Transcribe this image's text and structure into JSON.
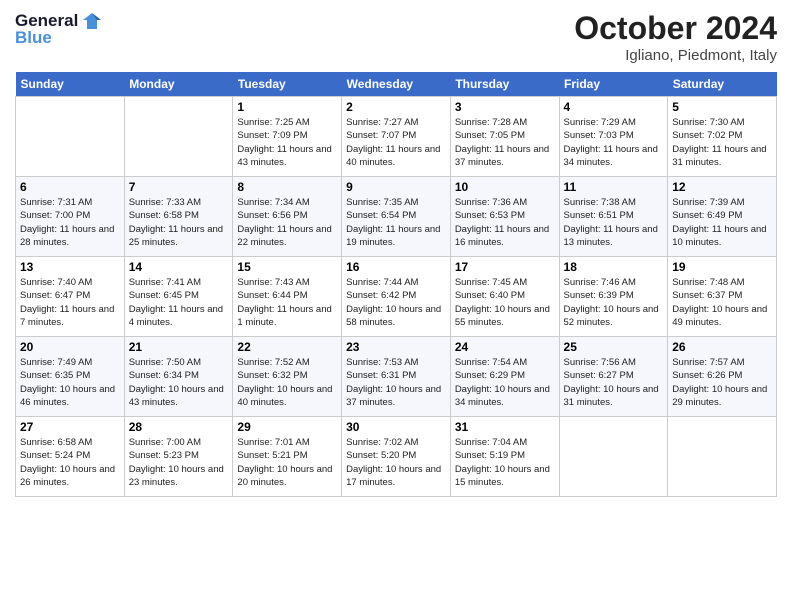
{
  "header": {
    "logo_general": "General",
    "logo_blue": "Blue",
    "month_title": "October 2024",
    "location": "Igliano, Piedmont, Italy"
  },
  "calendar": {
    "days_of_week": [
      "Sunday",
      "Monday",
      "Tuesday",
      "Wednesday",
      "Thursday",
      "Friday",
      "Saturday"
    ],
    "weeks": [
      [
        {
          "day": "",
          "sunrise": "",
          "sunset": "",
          "daylight": ""
        },
        {
          "day": "",
          "sunrise": "",
          "sunset": "",
          "daylight": ""
        },
        {
          "day": "1",
          "sunrise": "Sunrise: 7:25 AM",
          "sunset": "Sunset: 7:09 PM",
          "daylight": "Daylight: 11 hours and 43 minutes."
        },
        {
          "day": "2",
          "sunrise": "Sunrise: 7:27 AM",
          "sunset": "Sunset: 7:07 PM",
          "daylight": "Daylight: 11 hours and 40 minutes."
        },
        {
          "day": "3",
          "sunrise": "Sunrise: 7:28 AM",
          "sunset": "Sunset: 7:05 PM",
          "daylight": "Daylight: 11 hours and 37 minutes."
        },
        {
          "day": "4",
          "sunrise": "Sunrise: 7:29 AM",
          "sunset": "Sunset: 7:03 PM",
          "daylight": "Daylight: 11 hours and 34 minutes."
        },
        {
          "day": "5",
          "sunrise": "Sunrise: 7:30 AM",
          "sunset": "Sunset: 7:02 PM",
          "daylight": "Daylight: 11 hours and 31 minutes."
        }
      ],
      [
        {
          "day": "6",
          "sunrise": "Sunrise: 7:31 AM",
          "sunset": "Sunset: 7:00 PM",
          "daylight": "Daylight: 11 hours and 28 minutes."
        },
        {
          "day": "7",
          "sunrise": "Sunrise: 7:33 AM",
          "sunset": "Sunset: 6:58 PM",
          "daylight": "Daylight: 11 hours and 25 minutes."
        },
        {
          "day": "8",
          "sunrise": "Sunrise: 7:34 AM",
          "sunset": "Sunset: 6:56 PM",
          "daylight": "Daylight: 11 hours and 22 minutes."
        },
        {
          "day": "9",
          "sunrise": "Sunrise: 7:35 AM",
          "sunset": "Sunset: 6:54 PM",
          "daylight": "Daylight: 11 hours and 19 minutes."
        },
        {
          "day": "10",
          "sunrise": "Sunrise: 7:36 AM",
          "sunset": "Sunset: 6:53 PM",
          "daylight": "Daylight: 11 hours and 16 minutes."
        },
        {
          "day": "11",
          "sunrise": "Sunrise: 7:38 AM",
          "sunset": "Sunset: 6:51 PM",
          "daylight": "Daylight: 11 hours and 13 minutes."
        },
        {
          "day": "12",
          "sunrise": "Sunrise: 7:39 AM",
          "sunset": "Sunset: 6:49 PM",
          "daylight": "Daylight: 11 hours and 10 minutes."
        }
      ],
      [
        {
          "day": "13",
          "sunrise": "Sunrise: 7:40 AM",
          "sunset": "Sunset: 6:47 PM",
          "daylight": "Daylight: 11 hours and 7 minutes."
        },
        {
          "day": "14",
          "sunrise": "Sunrise: 7:41 AM",
          "sunset": "Sunset: 6:45 PM",
          "daylight": "Daylight: 11 hours and 4 minutes."
        },
        {
          "day": "15",
          "sunrise": "Sunrise: 7:43 AM",
          "sunset": "Sunset: 6:44 PM",
          "daylight": "Daylight: 11 hours and 1 minute."
        },
        {
          "day": "16",
          "sunrise": "Sunrise: 7:44 AM",
          "sunset": "Sunset: 6:42 PM",
          "daylight": "Daylight: 10 hours and 58 minutes."
        },
        {
          "day": "17",
          "sunrise": "Sunrise: 7:45 AM",
          "sunset": "Sunset: 6:40 PM",
          "daylight": "Daylight: 10 hours and 55 minutes."
        },
        {
          "day": "18",
          "sunrise": "Sunrise: 7:46 AM",
          "sunset": "Sunset: 6:39 PM",
          "daylight": "Daylight: 10 hours and 52 minutes."
        },
        {
          "day": "19",
          "sunrise": "Sunrise: 7:48 AM",
          "sunset": "Sunset: 6:37 PM",
          "daylight": "Daylight: 10 hours and 49 minutes."
        }
      ],
      [
        {
          "day": "20",
          "sunrise": "Sunrise: 7:49 AM",
          "sunset": "Sunset: 6:35 PM",
          "daylight": "Daylight: 10 hours and 46 minutes."
        },
        {
          "day": "21",
          "sunrise": "Sunrise: 7:50 AM",
          "sunset": "Sunset: 6:34 PM",
          "daylight": "Daylight: 10 hours and 43 minutes."
        },
        {
          "day": "22",
          "sunrise": "Sunrise: 7:52 AM",
          "sunset": "Sunset: 6:32 PM",
          "daylight": "Daylight: 10 hours and 40 minutes."
        },
        {
          "day": "23",
          "sunrise": "Sunrise: 7:53 AM",
          "sunset": "Sunset: 6:31 PM",
          "daylight": "Daylight: 10 hours and 37 minutes."
        },
        {
          "day": "24",
          "sunrise": "Sunrise: 7:54 AM",
          "sunset": "Sunset: 6:29 PM",
          "daylight": "Daylight: 10 hours and 34 minutes."
        },
        {
          "day": "25",
          "sunrise": "Sunrise: 7:56 AM",
          "sunset": "Sunset: 6:27 PM",
          "daylight": "Daylight: 10 hours and 31 minutes."
        },
        {
          "day": "26",
          "sunrise": "Sunrise: 7:57 AM",
          "sunset": "Sunset: 6:26 PM",
          "daylight": "Daylight: 10 hours and 29 minutes."
        }
      ],
      [
        {
          "day": "27",
          "sunrise": "Sunrise: 6:58 AM",
          "sunset": "Sunset: 5:24 PM",
          "daylight": "Daylight: 10 hours and 26 minutes."
        },
        {
          "day": "28",
          "sunrise": "Sunrise: 7:00 AM",
          "sunset": "Sunset: 5:23 PM",
          "daylight": "Daylight: 10 hours and 23 minutes."
        },
        {
          "day": "29",
          "sunrise": "Sunrise: 7:01 AM",
          "sunset": "Sunset: 5:21 PM",
          "daylight": "Daylight: 10 hours and 20 minutes."
        },
        {
          "day": "30",
          "sunrise": "Sunrise: 7:02 AM",
          "sunset": "Sunset: 5:20 PM",
          "daylight": "Daylight: 10 hours and 17 minutes."
        },
        {
          "day": "31",
          "sunrise": "Sunrise: 7:04 AM",
          "sunset": "Sunset: 5:19 PM",
          "daylight": "Daylight: 10 hours and 15 minutes."
        },
        {
          "day": "",
          "sunrise": "",
          "sunset": "",
          "daylight": ""
        },
        {
          "day": "",
          "sunrise": "",
          "sunset": "",
          "daylight": ""
        }
      ]
    ]
  }
}
